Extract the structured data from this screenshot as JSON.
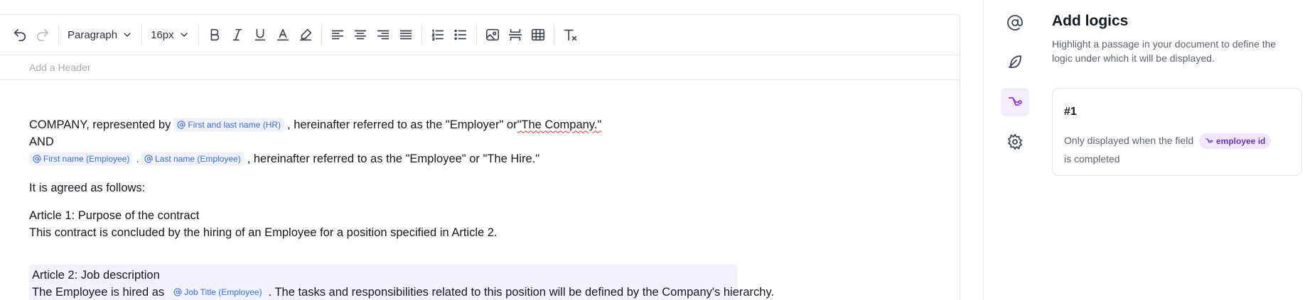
{
  "toolbar": {
    "block_format": "Paragraph",
    "font_size": "16px"
  },
  "header_placeholder": "Add a Header",
  "document": {
    "l1_before": "COMPANY, represented by",
    "l1_var": "First and last name (HR)",
    "l1_after": ", hereinafter referred to as the \"Employer\" or ",
    "l1_quoted": "\"The Company.\"",
    "l2": "AND",
    "l3_var1": "First name (Employee)",
    "l3_var2": "Last name (Employee)",
    "l3_after": ", hereinafter referred to as the \"Employee\" or \"The Hire.\"",
    "l4": "It is agreed as follows:",
    "l5": "Article 1: Purpose of the contract",
    "l6": "This contract is concluded by the hiring of an Employee for a position specified in Article 2.",
    "l7": "Article 2: Job description",
    "l8_before": "The Employee is hired as",
    "l8_var": "Job Title (Employee)",
    "l8_after": ". The tasks and responsibilities related to this position will be defined by the Company's hierarchy."
  },
  "rail": {
    "items": [
      {
        "icon": "at-sign-icon"
      },
      {
        "icon": "feather-icon"
      },
      {
        "icon": "logic-branch-icon",
        "active": true
      },
      {
        "icon": "gear-icon"
      }
    ]
  },
  "panel": {
    "title": "Add logics",
    "description": "Highlight a passage in your document to define the logic under which it will be displayed.",
    "card": {
      "number": "#1",
      "text_before": "Only displayed when the field",
      "field": "employee id",
      "text_after": "is completed"
    }
  },
  "colors": {
    "accent": "#8a3ce0",
    "variable_chip_bg": "#eef3ff",
    "variable_chip_text": "#3f6ddb",
    "highlight_block": "#f5f0fd"
  }
}
